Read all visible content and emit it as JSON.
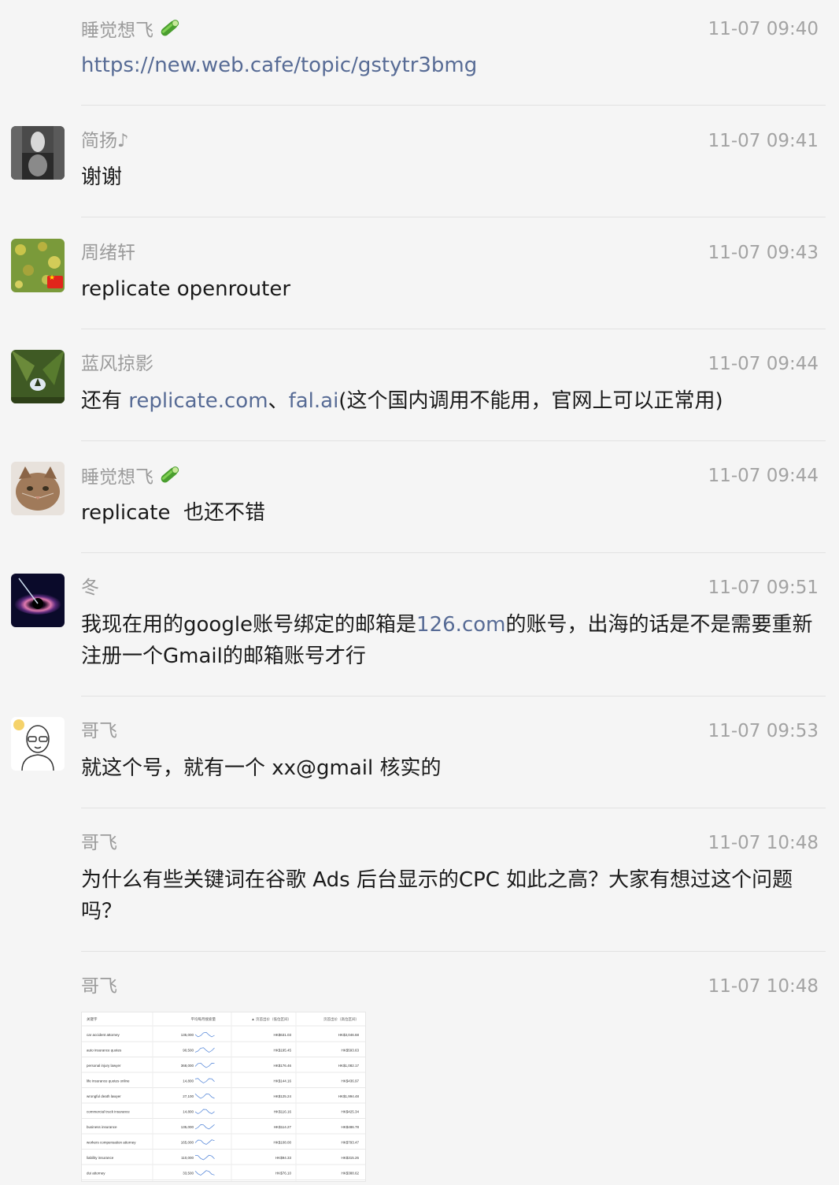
{
  "colors": {
    "link": "#576b95",
    "name": "#9b9b9b",
    "time": "#a3a3a3",
    "background": "#f5f5f5"
  },
  "messages": [
    {
      "name": "睡觉想飞",
      "name_icon": "cucumber-icon",
      "time": "11-07 09:40",
      "link": "https://new.web.cafe/topic/gstytr3bmg"
    },
    {
      "name": "简扬♪",
      "time": "11-07 09:41",
      "text": "谢谢"
    },
    {
      "name": "周绪轩",
      "time": "11-07 09:43",
      "text": "replicate openrouter"
    },
    {
      "name": "蓝风掠影",
      "time": "11-07 09:44",
      "text_parts": [
        "还有 ",
        "replicate.com",
        "、",
        "fal.ai",
        "(这个国内调用不能用，官网上可以正常用)"
      ]
    },
    {
      "name": "睡觉想飞",
      "name_icon": "cucumber-icon",
      "time": "11-07 09:44",
      "text": "replicate  也还不错"
    },
    {
      "name": "冬",
      "time": "11-07 09:51",
      "text_parts": [
        "我现在用的google账号绑定的邮箱是",
        "126.com",
        "的账号，出海的话是不是需要重新注册一个Gmail的邮箱账号才行"
      ]
    },
    {
      "name": "哥飞",
      "time": "11-07 09:53",
      "text": "就这个号，就有一个 xx@gmail 核实的"
    },
    {
      "name": "哥飞",
      "time": "11-07 10:48",
      "text": "为什么有些关键词在谷歌 Ads 后台显示的CPC 如此之高？大家有想过这个问题吗？"
    },
    {
      "name": "哥飞",
      "time": "11-07 10:48",
      "attachment": "keyword-table-screenshot"
    }
  ],
  "table_image": {
    "headers": [
      "关键字",
      "平均每月搜索量",
      "▲ 页首出价（低位区间）",
      "页首出价（高位区间）"
    ],
    "rows": [
      [
        "car accident attorney",
        "135,000",
        "HK$631.03",
        "HK$3,046.68"
      ],
      [
        "auto insurance quotes",
        "90,500",
        "HK$195.45",
        "HK$593.63"
      ],
      [
        "personal injury lawyer",
        "368,000",
        "HK$176.46",
        "HK$1,082.17"
      ],
      [
        "life insurance quotes online",
        "14,800",
        "HK$144.16",
        "HK$436.97"
      ],
      [
        "wrongful death lawyer",
        "27,100",
        "HK$125.24",
        "HK$1,994.48"
      ],
      [
        "commercial truck insurance",
        "14,800",
        "HK$116.16",
        "HK$425.34"
      ],
      [
        "business insurance",
        "135,000",
        "HK$114.27",
        "HK$486.78"
      ],
      [
        "workers compensation attorney",
        "165,000",
        "HK$108.00",
        "HK$793.47"
      ],
      [
        "liability insurance",
        "110,000",
        "HK$94.33",
        "HK$315.26"
      ],
      [
        "dui attorney",
        "33,500",
        "HK$76.10",
        "HK$388.62"
      ]
    ]
  }
}
